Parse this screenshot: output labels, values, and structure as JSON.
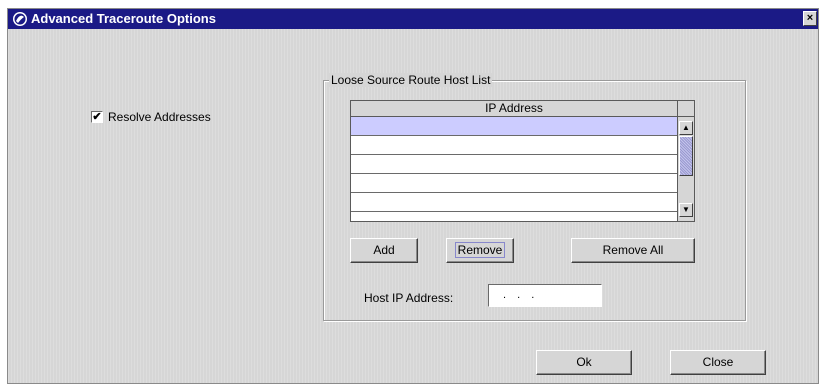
{
  "window": {
    "title": "Advanced Traceroute Options",
    "close_glyph": "×"
  },
  "options": {
    "resolve_addresses": {
      "label": "Resolve Addresses",
      "checked": true,
      "mark": "✔"
    }
  },
  "loose_source_route": {
    "group_label": "Loose Source Route Host List",
    "table": {
      "column_header": "IP Address",
      "rows": [
        "",
        "",
        "",
        "",
        ""
      ],
      "selected_row": 0
    },
    "buttons": {
      "add": "Add",
      "remove": "Remove",
      "remove_all": "Remove All"
    },
    "host_ip_label": "Host IP Address:",
    "host_ip_value": ". . ."
  },
  "footer": {
    "ok": "Ok",
    "close": "Close"
  },
  "colors": {
    "titlebar": "#1b1a86",
    "dialog_bg": "#d6d6d6",
    "selected_row": "#ccccff"
  },
  "icons": {
    "window_icon": "app-globe-icon",
    "scroll_up": "▲",
    "scroll_down": "▼"
  }
}
